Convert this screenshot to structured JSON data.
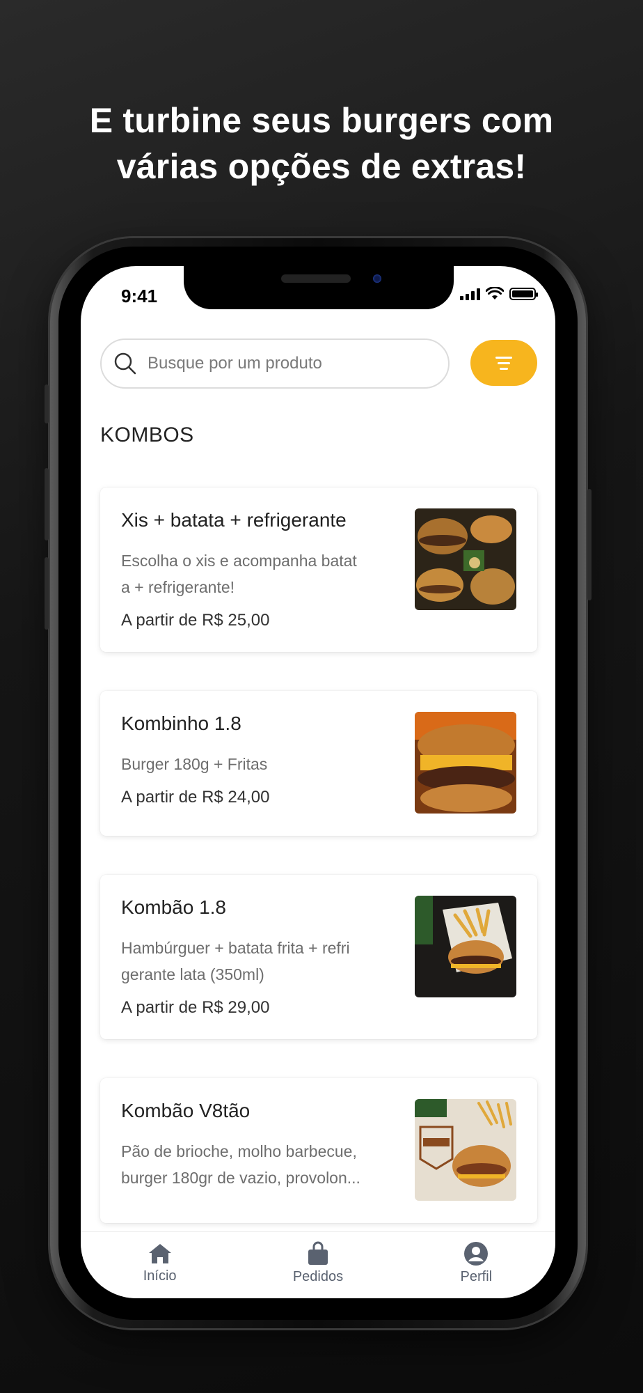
{
  "headline": {
    "line1": "E turbine seus burgers com",
    "line2": "várias opções de extras!"
  },
  "status_bar": {
    "time": "9:41"
  },
  "search": {
    "placeholder": "Busque por um produto"
  },
  "section": {
    "title": "KOMBOS"
  },
  "products": [
    {
      "title": "Xis + batata + refrigerante",
      "desc_line1": "Escolha o xis e acompanha batat",
      "desc_line2": "a + refrigerante!",
      "price": "A partir de R$ 25,00"
    },
    {
      "title": "Kombinho 1.8",
      "desc_line1": "Burger 180g + Fritas",
      "price": "A partir de R$ 24,00"
    },
    {
      "title": "Kombão 1.8",
      "desc_line1": "Hambúrguer + batata frita + refri",
      "desc_line2": "gerante lata (350ml)",
      "price": "A partir de R$ 29,00"
    },
    {
      "title": "Kombão V8tão",
      "desc_line1": "Pão de brioche, molho barbecue,",
      "desc_line2": "burger 180gr de vazio, provolon..."
    }
  ],
  "tabbar": {
    "items": [
      {
        "label": "Início",
        "icon": "home-icon"
      },
      {
        "label": "Pedidos",
        "icon": "bag-icon"
      },
      {
        "label": "Perfil",
        "icon": "user-icon"
      }
    ]
  },
  "colors": {
    "accent": "#f7b51e",
    "tab_icon": "#5a6270"
  }
}
